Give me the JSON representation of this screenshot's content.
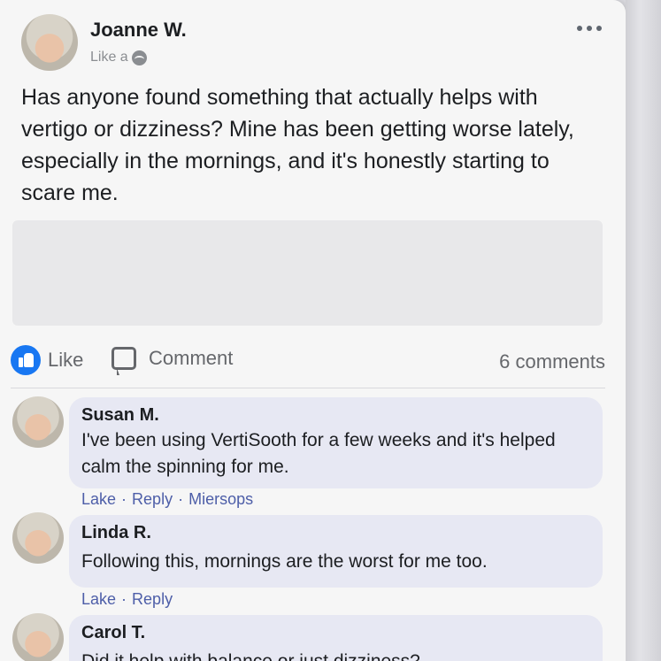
{
  "post": {
    "author": "Joanne W.",
    "sub_label": "Like a",
    "text": "Has anyone found something that actually helps with vertigo or dizziness? Mine has been getting worse lately, especially in the mornings, and it's honestly starting to scare me."
  },
  "actions": {
    "like_label": "Like",
    "comment_label": "Comment",
    "comment_count": "6 comments"
  },
  "comments": [
    {
      "name": "Susan M.",
      "text": "I've been using VertiSooth for a few weeks and it's helped calm the spinning for me.",
      "actions": [
        "Lake",
        "Reply",
        "Miersops"
      ]
    },
    {
      "name": "Linda R.",
      "text": "Following this, mornings are the worst for me too.",
      "actions": [
        "Lake",
        "Reply"
      ]
    },
    {
      "name": "Carol T.",
      "text": "Did it help with balance or just dizziness?"
    }
  ],
  "colors": {
    "accent": "#1877f2",
    "bubble": "#e7e8f3",
    "link": "#4d5ea8"
  }
}
